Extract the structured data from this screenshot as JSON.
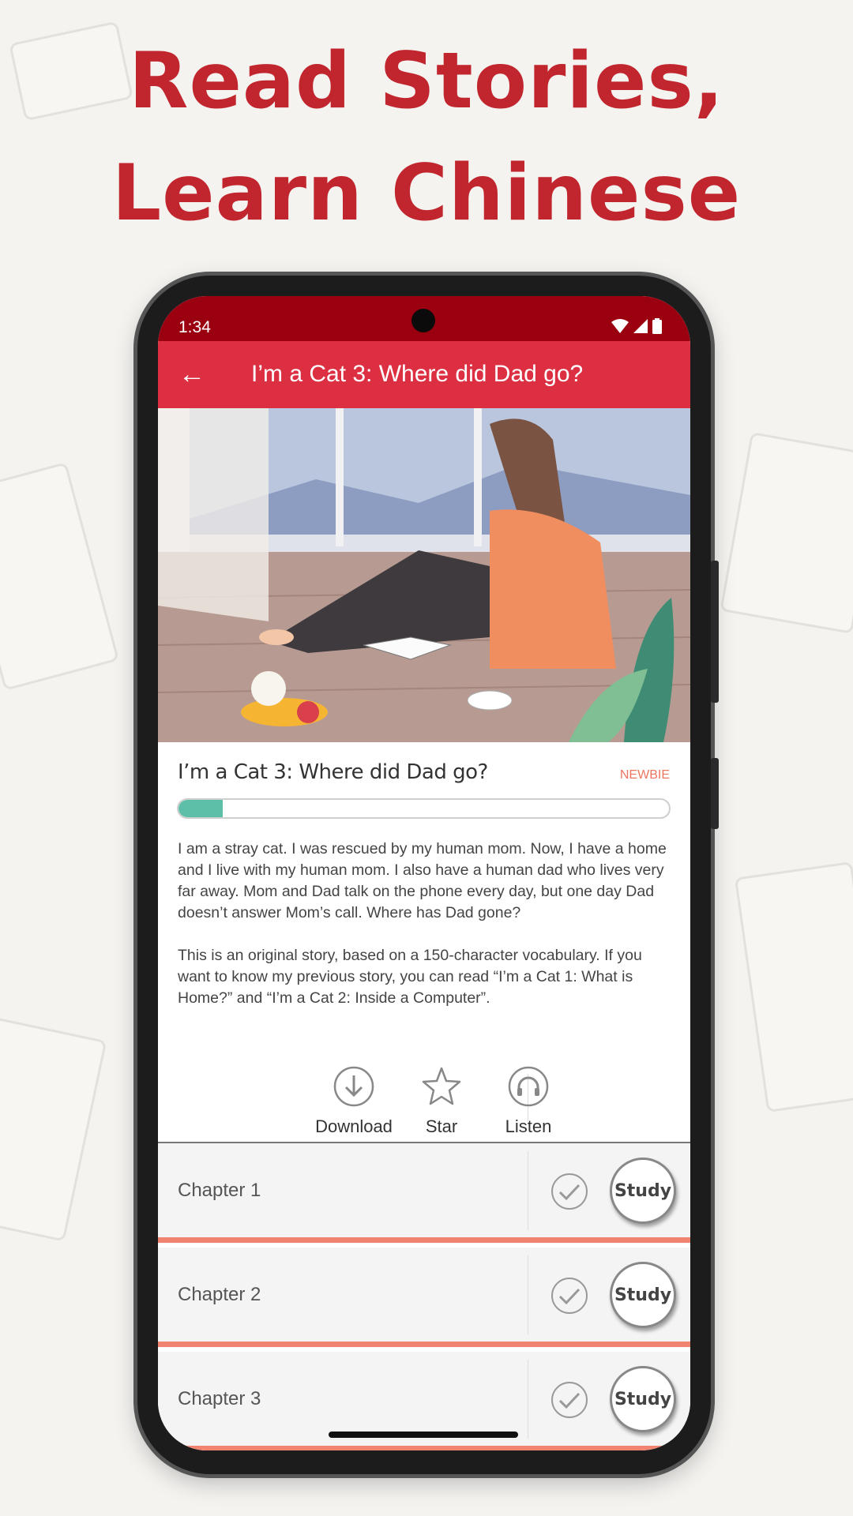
{
  "headline": {
    "line1": "Read Stories,",
    "line2": "Learn Chinese"
  },
  "status_bar": {
    "time": "1:34",
    "icons": [
      "wifi-icon",
      "signal-icon",
      "battery-icon"
    ]
  },
  "app_bar": {
    "back_icon": "arrow-left-icon",
    "title": "I’m a Cat 3: Where did Dad go?"
  },
  "story": {
    "title": "I’m a Cat 3: Where did Dad go?",
    "level": "NEWBIE",
    "progress_percent": 9,
    "description": [
      "I am a stray cat. I was rescued by my human mom. Now, I have a home and I live with my human mom. I also have a human dad who lives very far away. Mom and Dad talk on the phone every day, but one day Dad doesn’t answer Mom’s call. Where has Dad gone?",
      "This is an original story, based on a 150-character vocabulary. If you want to know my previous story, you can read “I’m a Cat 1: What is Home?” and “I’m a Cat 2: Inside a Computer”."
    ]
  },
  "actions": [
    {
      "label": "Download",
      "icon": "download-icon"
    },
    {
      "label": "Star",
      "icon": "star-icon"
    },
    {
      "label": "Listen",
      "icon": "headphones-icon"
    }
  ],
  "chapters": [
    {
      "name": "Chapter 1",
      "study_label": "Study"
    },
    {
      "name": "Chapter 2",
      "study_label": "Study"
    },
    {
      "name": "Chapter 3",
      "study_label": "Study"
    }
  ],
  "colors": {
    "headline": "#c1262e",
    "status_bar": "#9b0011",
    "app_bar": "#dc3042",
    "progress": "#5dbfa8",
    "chapter_divider": "#f08471",
    "level": "#ee7560"
  }
}
